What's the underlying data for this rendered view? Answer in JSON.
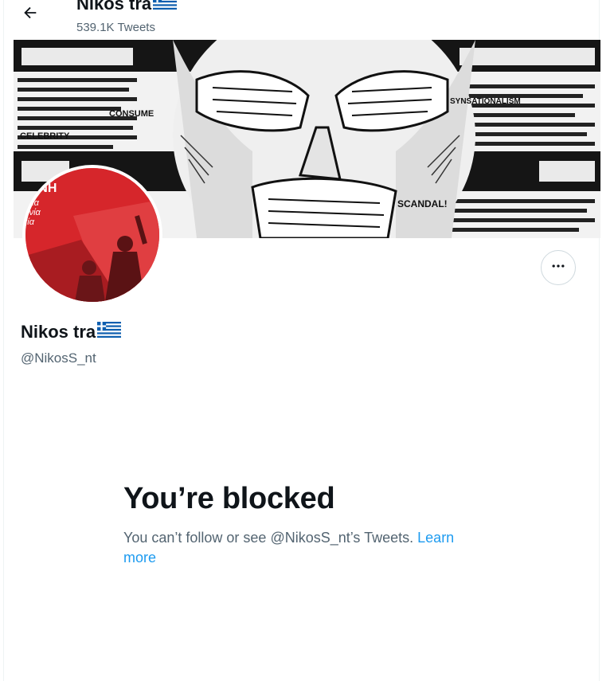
{
  "header": {
    "title": "Nikos tra",
    "tweet_count": "539.1K Tweets"
  },
  "profile": {
    "display_name": "Nikos tra",
    "handle": "@NikosS_nt",
    "avatar_text_lines": [
      "ΣΥΝΗ",
      "ουία",
      "ωνία",
      "αία"
    ],
    "banner_words": [
      "CONSUME",
      "CELEBRITY",
      "SYNSATIONALISM",
      "SCANDAL!"
    ]
  },
  "blocked": {
    "title": "You’re blocked",
    "message": "You can’t follow or see @NikosS_nt’s Tweets.",
    "link": "Learn more"
  },
  "icons": {
    "back": "arrow-left-icon",
    "more": "more-horizontal-icon",
    "flag": "greece-flag-icon"
  },
  "colors": {
    "link": "#1d9bf0",
    "secondary_text": "#536471",
    "primary_text": "#0f1419",
    "avatar_red": "#d6262b"
  }
}
